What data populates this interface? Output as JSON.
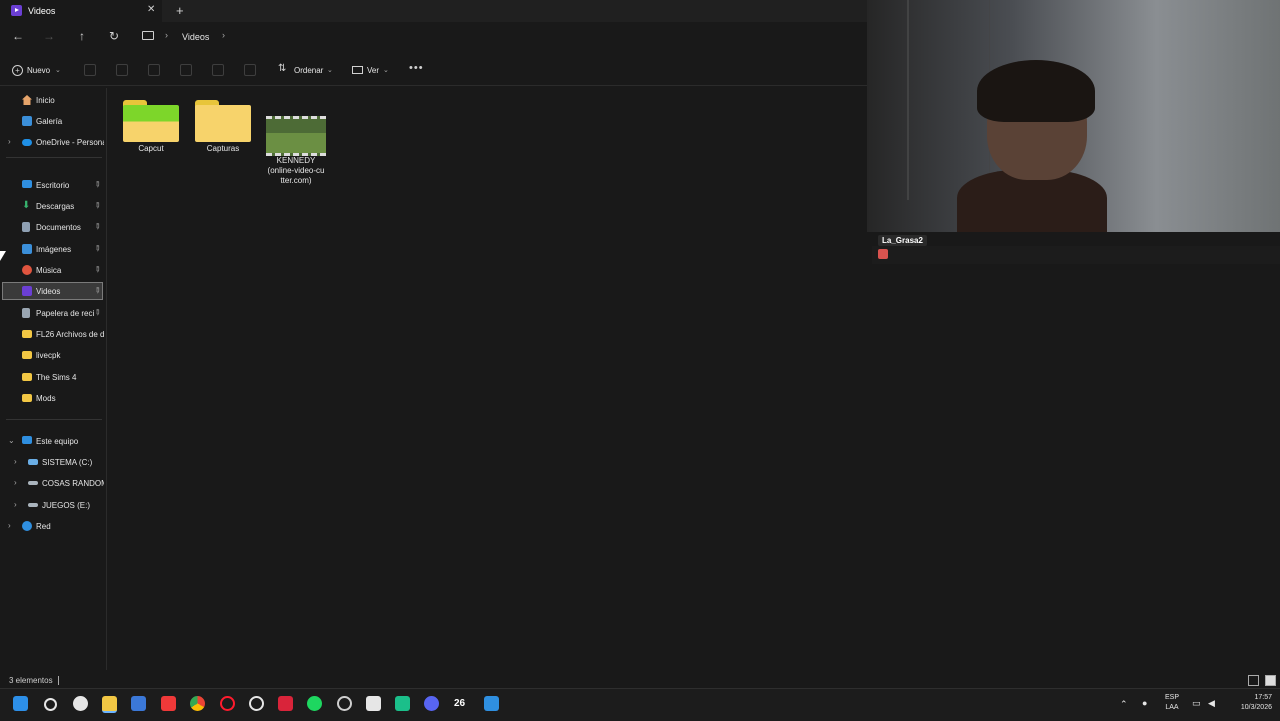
{
  "window": {
    "tab_title": "Videos",
    "tab_close_icon": "close-icon",
    "new_tab_icon": "plus-icon"
  },
  "navigation": {
    "back_icon": "arrow-left-icon",
    "forward_icon": "arrow-right-icon",
    "up_icon": "arrow-up-icon",
    "refresh_icon": "refresh-icon",
    "breadcrumb": [
      "Videos"
    ]
  },
  "toolbar": {
    "new_label": "Nuevo",
    "sort_label": "Ordenar",
    "view_label": "Ver",
    "more_icon": "more-icon"
  },
  "sidebar": {
    "top_items": [
      {
        "label": "Inicio",
        "icon": "home-icon",
        "color": "#e6a46a"
      },
      {
        "label": "Galería",
        "icon": "gallery-icon",
        "color": "#3b8fd9"
      },
      {
        "label": "OneDrive - Persona",
        "icon": "cloud-icon",
        "color": "#1f8fe5"
      }
    ],
    "pinned_items": [
      {
        "label": "Escritorio",
        "icon": "desktop-icon",
        "color": "#2f8fe0"
      },
      {
        "label": "Descargas",
        "icon": "download-icon",
        "color": "#37b36e"
      },
      {
        "label": "Documentos",
        "icon": "document-icon",
        "color": "#8fa0b3"
      },
      {
        "label": "Imágenes",
        "icon": "image-icon",
        "color": "#3b8fd9"
      },
      {
        "label": "Música",
        "icon": "music-icon",
        "color": "#e0553f"
      },
      {
        "label": "Videos",
        "icon": "video-icon",
        "color": "#6b3fd4"
      },
      {
        "label": "Papelera de recic",
        "icon": "recycle-bin-icon",
        "color": "#9aa6b2"
      }
    ],
    "folder_items": [
      {
        "label": "FL26 Archivos de d",
        "icon": "folder-icon",
        "color": "#f2c744"
      },
      {
        "label": "livecpk",
        "icon": "folder-icon",
        "color": "#f2c744"
      },
      {
        "label": "The Sims 4",
        "icon": "folder-icon",
        "color": "#f2c744"
      },
      {
        "label": "Mods",
        "icon": "folder-icon",
        "color": "#f2c744"
      }
    ],
    "this_pc": {
      "label": "Este equipo",
      "icon": "pc-icon",
      "color": "#2f8fe0"
    },
    "drives": [
      {
        "label": "SISTEMA (C:)",
        "icon": "drive-icon",
        "color": "#6aaee6"
      },
      {
        "label": "COSAS RANDOM",
        "icon": "drive-icon",
        "color": "#aab4bd"
      },
      {
        "label": "JUEGOS (E:)",
        "icon": "drive-icon",
        "color": "#aab4bd"
      }
    ],
    "network": {
      "label": "Red",
      "icon": "network-icon",
      "color": "#2f8fe0"
    }
  },
  "files": [
    {
      "name": "Capcut",
      "type": "folder",
      "color": "#7dd62a"
    },
    {
      "name": "Capturas",
      "type": "folder",
      "color": "#f7d36b"
    },
    {
      "name_lines": [
        "KENNEDY",
        "(online-video-cu",
        "tter.com)"
      ],
      "type": "video"
    }
  ],
  "status": {
    "count": "3 elementos"
  },
  "overlay": {
    "username": "La_Grasa2"
  },
  "taskbar": {
    "apps": [
      "windows-start-icon",
      "search-icon",
      "settings-icon",
      "file-explorer-icon",
      "store-icon",
      "vivaldi-icon",
      "chrome-icon",
      "opera-icon",
      "opera-gx-icon",
      "app-red-icon",
      "spotify-icon",
      "chatgpt-icon",
      "capcut-icon",
      "app-green-icon",
      "discord-icon",
      "fc26-icon",
      "app-blue-icon"
    ],
    "fc_label": "26",
    "lang_top": "ESP",
    "lang_bottom": "LAA",
    "time": "17:57",
    "date": "10/3/2026"
  }
}
